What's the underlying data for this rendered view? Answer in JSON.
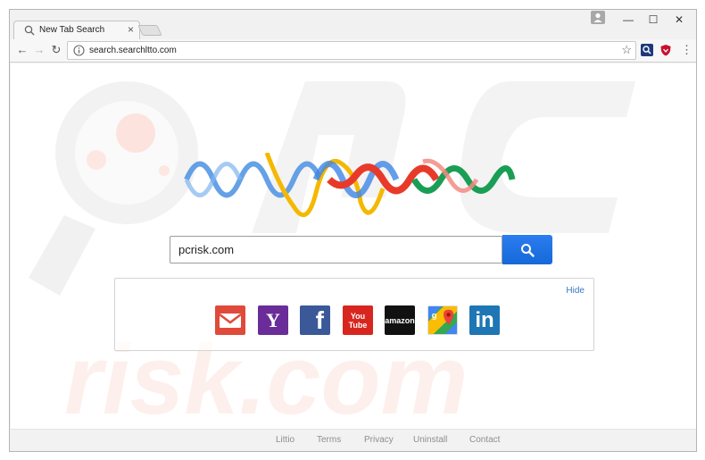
{
  "browser": {
    "tab_title": "New Tab Search",
    "tab_close": "×",
    "url": "search.searchltto.com",
    "window_controls": {
      "minimize": "—",
      "maximize": "☐",
      "close": "✕"
    },
    "nav": {
      "back": "←",
      "forward": "→",
      "reload": "↻"
    },
    "star": "☆",
    "menu": "⋮"
  },
  "page": {
    "search": {
      "value": "pcrisk.com"
    },
    "quick_links": {
      "hide_label": "Hide",
      "items": [
        {
          "name": "gmail",
          "label": "",
          "color": "#e04a3a"
        },
        {
          "name": "yahoo",
          "label": "Y",
          "color": "#6a2c99"
        },
        {
          "name": "facebook",
          "label": "f",
          "color": "#3b5999"
        },
        {
          "name": "youtube",
          "label": "You Tube",
          "color": "#d8261f"
        },
        {
          "name": "amazon",
          "label": "amazon",
          "color": "#111111"
        },
        {
          "name": "google-maps",
          "label": "",
          "color": "#ffffff"
        },
        {
          "name": "linkedin",
          "label": "in",
          "color": "#1f76b5"
        }
      ]
    },
    "footer": [
      "Littio",
      "Terms",
      "Privacy",
      "Uninstall",
      "Contact"
    ]
  },
  "watermark": {
    "text": "risk.com"
  }
}
